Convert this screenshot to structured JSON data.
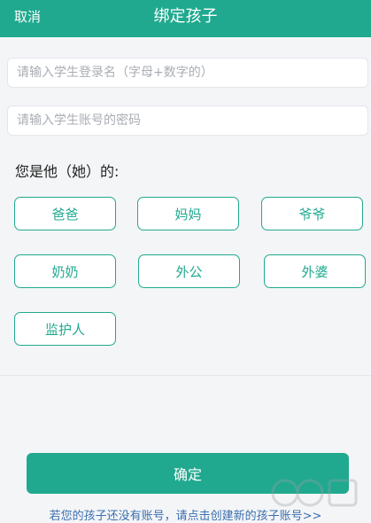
{
  "header": {
    "cancel_label": "取消",
    "title": "绑定孩子"
  },
  "form": {
    "username_placeholder": "请输入学生登录名（字母+数字的）",
    "password_placeholder": "请输入学生账号的密码",
    "relation_prompt": "您是他（她）的:"
  },
  "relations": [
    "爸爸",
    "妈妈",
    "爷爷",
    "奶奶",
    "外公",
    "外婆",
    "监护人"
  ],
  "footer": {
    "confirm_label": "确定",
    "create_link": "若您的孩子还没有账号，请点击创建新的孩子账号>>"
  },
  "colors": {
    "accent": "#20a98f",
    "link": "#3a6fb0"
  }
}
